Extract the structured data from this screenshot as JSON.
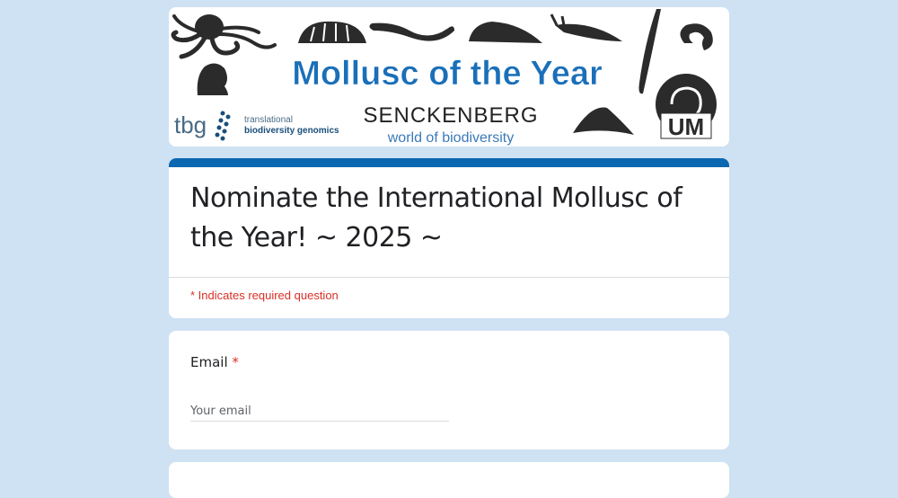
{
  "banner": {
    "title": "Mollusc of the Year",
    "tbg_logo": "tbg",
    "tbg_line1": "translational",
    "tbg_line2": "biodiversity genomics",
    "senckenberg": "SENCKENBERG",
    "senckenberg_sub": "world of biodiversity",
    "um_logo": "UM",
    "title_color": "#1a6fb8"
  },
  "form": {
    "title": "Nominate the International Mollusc of the Year! ~ 2025 ~",
    "required_note": "* Indicates required question",
    "accent_color": "#0b67b0"
  },
  "email_question": {
    "label": "Email",
    "required_mark": "*",
    "placeholder": "Your email",
    "value": ""
  },
  "icons": [
    "octopus-icon",
    "chiton-icon",
    "worm-mollusc-icon",
    "slug-icon",
    "sea-slug-icon",
    "tusk-shell-icon",
    "nautilus-icon",
    "snail-shell-icon",
    "limpet-icon",
    "head-silhouette-icon",
    "dna-icon"
  ]
}
